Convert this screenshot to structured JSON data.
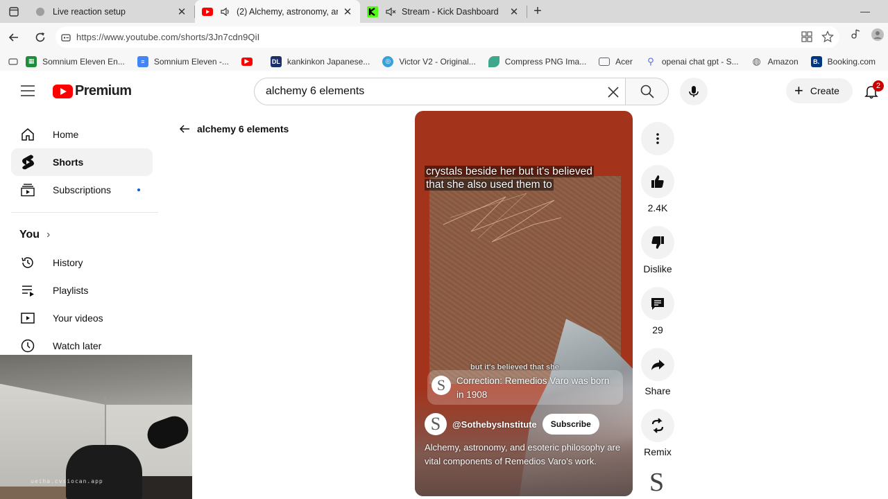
{
  "browser": {
    "tabs": [
      {
        "title": "Live reaction setup",
        "active": false
      },
      {
        "title": "(2) Alchemy, astronomy, and",
        "active": true
      },
      {
        "title": "Stream - Kick Dashboard",
        "active": false
      }
    ],
    "url": "https://www.youtube.com/shorts/3Jn7cdn9QiI",
    "bookmarks": [
      {
        "label": "Somnium Eleven En...",
        "icon": "sheets-icon",
        "color": "#1e8e3e"
      },
      {
        "label": "Somnium Eleven -...",
        "icon": "docs-icon",
        "color": "#4285f4"
      },
      {
        "label": "",
        "icon": "youtube-icon",
        "color": "#ff0000"
      },
      {
        "label": "kankinkon Japanese...",
        "icon": "dl-icon",
        "color": "#1c2f6b"
      },
      {
        "label": "Victor V2 - Original...",
        "icon": "circle-icon",
        "color": "#3aa0d8"
      },
      {
        "label": "Compress PNG Ima...",
        "icon": "leaf-icon",
        "color": "#3fa78b"
      },
      {
        "label": "Acer",
        "icon": "folder-icon",
        "color": "#5f6368"
      },
      {
        "label": "openai chat gpt - S...",
        "icon": "search-icon",
        "color": "#5b6bd6"
      },
      {
        "label": "Amazon",
        "icon": "globe-icon",
        "color": "#5f6368"
      },
      {
        "label": "Booking.com",
        "icon": "booking-icon",
        "color": "#003580"
      }
    ]
  },
  "youtube": {
    "logo_text": "Premium",
    "search_value": "alchemy 6 elements",
    "create_label": "Create",
    "notification_count": "2",
    "sidebar": {
      "main": [
        {
          "label": "Home",
          "icon": "home-icon",
          "active": false
        },
        {
          "label": "Shorts",
          "icon": "shorts-icon",
          "active": true
        },
        {
          "label": "Subscriptions",
          "icon": "subscriptions-icon",
          "active": false
        }
      ],
      "you_heading": "You",
      "you_items": [
        {
          "label": "History",
          "icon": "history-icon"
        },
        {
          "label": "Playlists",
          "icon": "playlists-icon"
        },
        {
          "label": "Your videos",
          "icon": "your-videos-icon"
        },
        {
          "label": "Watch later",
          "icon": "watch-later-icon"
        }
      ]
    },
    "back_label": "alchemy 6 elements",
    "short": {
      "caption_line1": "crystals beside her but it's believed",
      "caption_line2": "that she also used them to",
      "subcaption": "but it's believed that she",
      "correction": "Correction: Remedios Varo was born in 1908",
      "channel_handle": "@SothebysInstitute",
      "avatar_letter": "S",
      "subscribe_label": "Subscribe",
      "description": "Alchemy, astronomy, and esoteric philosophy are vital components of Remedios Varo's work."
    },
    "actions": {
      "likes": "2.4K",
      "dislike_label": "Dislike",
      "comments": "29",
      "share_label": "Share",
      "remix_label": "Remix",
      "sound_letter": "S"
    }
  },
  "webcam": {
    "watermark": "ueiha.cvsiocan.app"
  }
}
